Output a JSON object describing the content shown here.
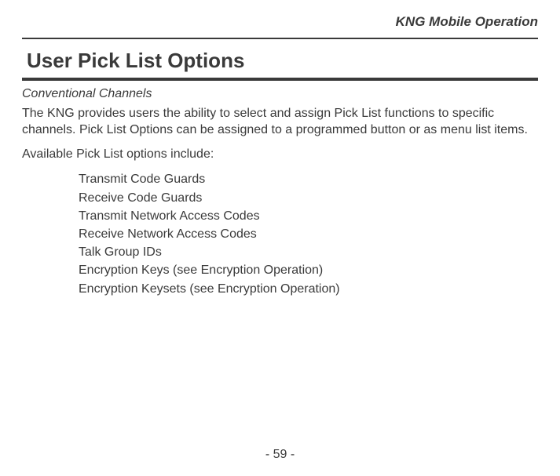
{
  "header": {
    "label": "KNG Mobile Operation"
  },
  "section": {
    "title": "User Pick List Options",
    "subheading": "Conventional Channels",
    "intro": "The KNG provides users the ability to select and assign Pick List functions to specific channels. Pick List Options can be assigned to a programmed button or as menu list items.",
    "list_intro": "Available Pick List options include:",
    "items": [
      "Transmit Code Guards",
      "Receive Code Guards",
      "Transmit Network Access Codes",
      "Receive Network Access Codes",
      "Talk Group IDs",
      "Encryption Keys (see Encryption Operation)",
      "Encryption Keysets (see Encryption Operation)"
    ]
  },
  "footer": {
    "page_number": "- 59 -"
  }
}
